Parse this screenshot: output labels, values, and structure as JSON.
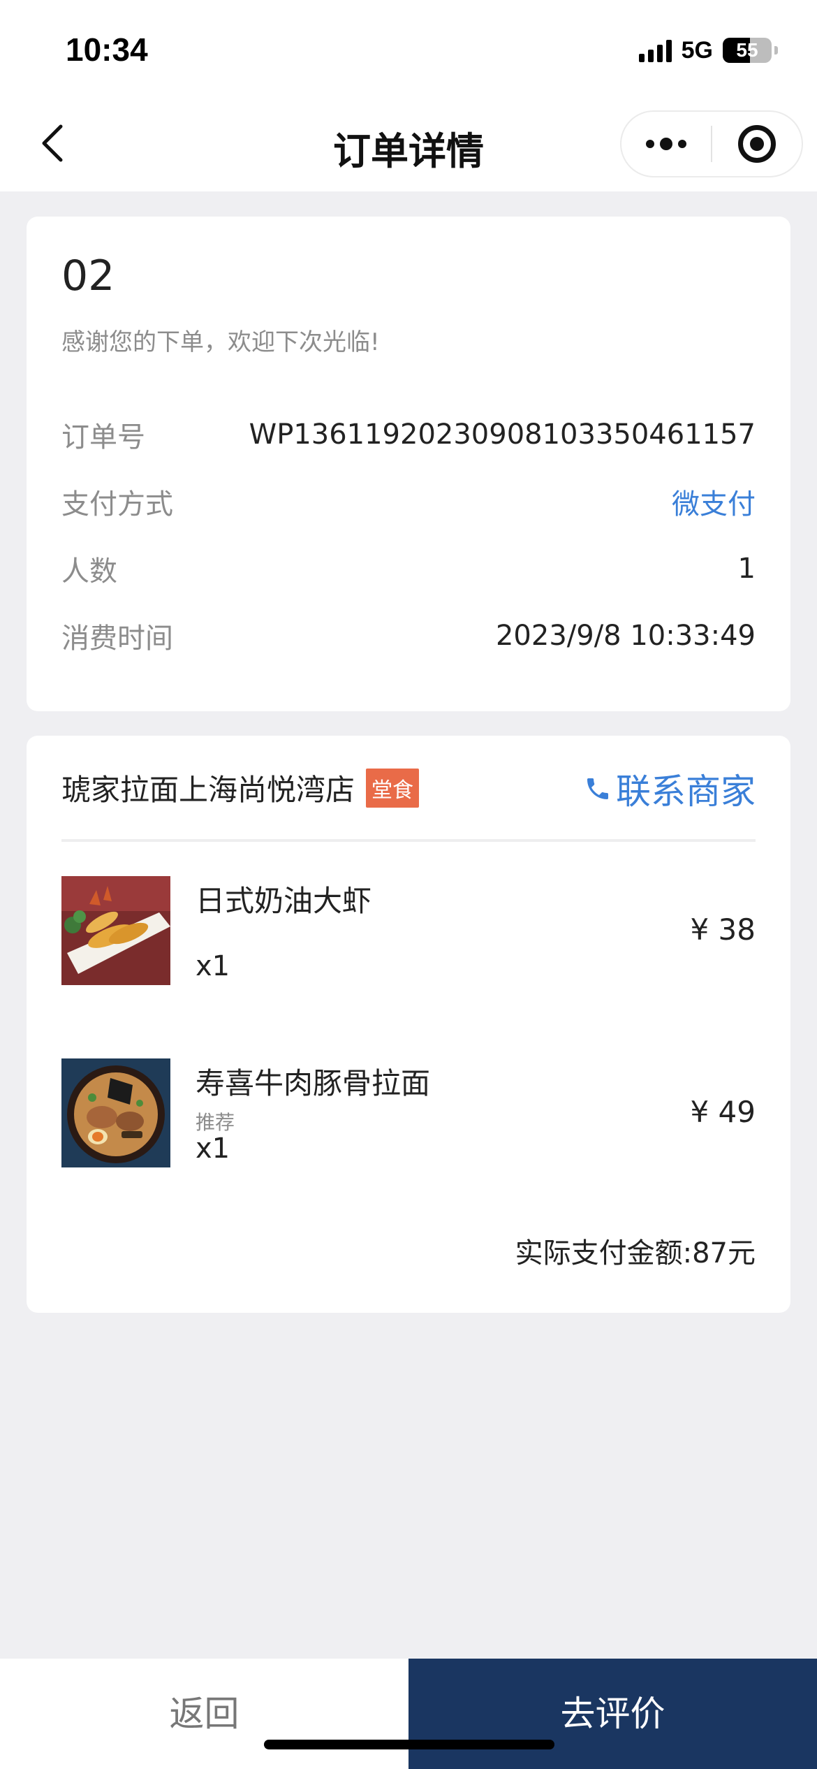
{
  "status_bar": {
    "time": "10:34",
    "network": "5G",
    "battery": "55",
    "battery_level": 0.55,
    "signal_icon": "signal-bars-icon"
  },
  "nav": {
    "title": "订单详情",
    "back_icon": "chevron-left-icon",
    "more_icon": "more-dots-icon",
    "close_icon": "target-circle-icon"
  },
  "order": {
    "number": "02",
    "thanks": "感谢您的下单，欢迎下次光临!",
    "rows": [
      {
        "label": "订单号",
        "value": "WP1361192023090810335046115​7"
      },
      {
        "label": "支付方式",
        "value": "微支付"
      },
      {
        "label": "人数",
        "value": "1"
      },
      {
        "label": "消费时间",
        "value": "2023/9/8 10:33:49"
      }
    ]
  },
  "store": {
    "name": "琥家拉面上海尚悦湾店",
    "tag": "堂食",
    "contact_label": "联系商家",
    "contact_icon": "phone-icon"
  },
  "items": [
    {
      "name": "日式奶油大虾",
      "sub": "",
      "qty": "x1",
      "price": "¥ 38",
      "image": "fried-shrimp-image"
    },
    {
      "name": "寿喜牛肉豚骨拉面",
      "sub": "推荐",
      "qty": "x1",
      "price": "¥ 49",
      "image": "ramen-bowl-image"
    }
  ],
  "total": "实际支付金额:87元",
  "bottom": {
    "back_label": "返回",
    "review_label": "去评价"
  },
  "colors": {
    "accent_blue": "#3a7fd8",
    "tag_orange": "#e96b48",
    "review_button": "#1a3661",
    "background": "#efeff2"
  }
}
